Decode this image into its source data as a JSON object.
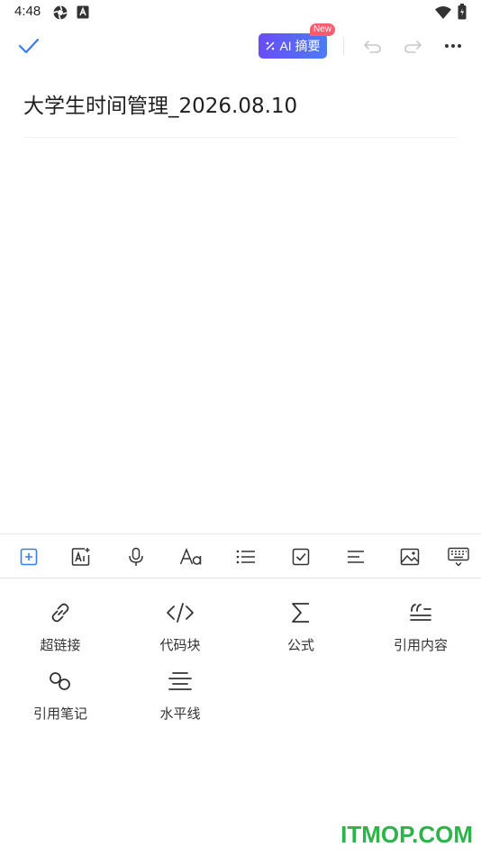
{
  "status_bar": {
    "time": "4:48",
    "icons": [
      "settings-icon",
      "a-badge-icon",
      "wifi-icon",
      "battery-icon"
    ]
  },
  "top_bar": {
    "confirm_icon": "check-icon",
    "ai_summary_label": "AI 摘要",
    "new_badge": "New",
    "undo_icon": "undo-icon",
    "redo_icon": "redo-icon",
    "more_icon": "more-icon"
  },
  "note": {
    "title": "大学生时间管理_2026.08.10"
  },
  "toolbar": {
    "items": [
      "insert-icon",
      "ai-write-icon",
      "microphone-icon",
      "text-format-icon",
      "bullet-list-icon",
      "checkbox-icon",
      "align-icon",
      "image-icon",
      "keyboard-hide-icon"
    ]
  },
  "insert_panel": {
    "items": [
      {
        "label": "超链接",
        "icon": "link-icon"
      },
      {
        "label": "代码块",
        "icon": "code-icon"
      },
      {
        "label": "公式",
        "icon": "sigma-icon"
      },
      {
        "label": "引用内容",
        "icon": "quote-icon"
      },
      {
        "label": "引用笔记",
        "icon": "note-link-icon"
      },
      {
        "label": "水平线",
        "icon": "horizontal-line-icon"
      }
    ]
  },
  "watermark": "ITMOP.COM",
  "colors": {
    "accent": "#3a7bf7",
    "ai_gradient_start": "#6a4cf5",
    "ai_gradient_end": "#4a7cf7",
    "badge": "#ff5c6e",
    "watermark": "#2db34a"
  }
}
